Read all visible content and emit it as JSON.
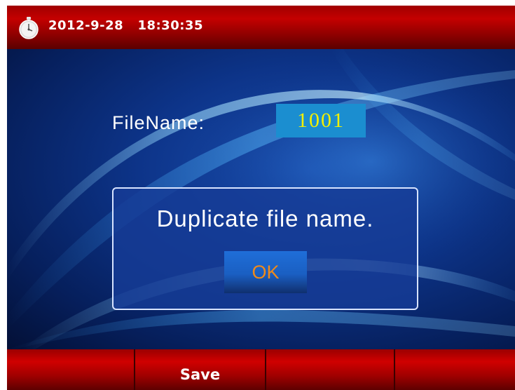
{
  "status_bar": {
    "date": "2012-9-28",
    "time": "18:30:35",
    "icon": "stopwatch-icon"
  },
  "form": {
    "filename_label": "FileName:",
    "filename_value": "1001"
  },
  "dialog": {
    "message": "Duplicate file name.",
    "ok_label": "OK"
  },
  "softkeys": [
    "",
    "Save",
    "",
    ""
  ],
  "colors": {
    "title_bar": "#c40000",
    "background": "#0d3489",
    "input_bg": "#1b8ed0",
    "input_text": "#f3f000",
    "ok_text": "#f08a1a"
  }
}
